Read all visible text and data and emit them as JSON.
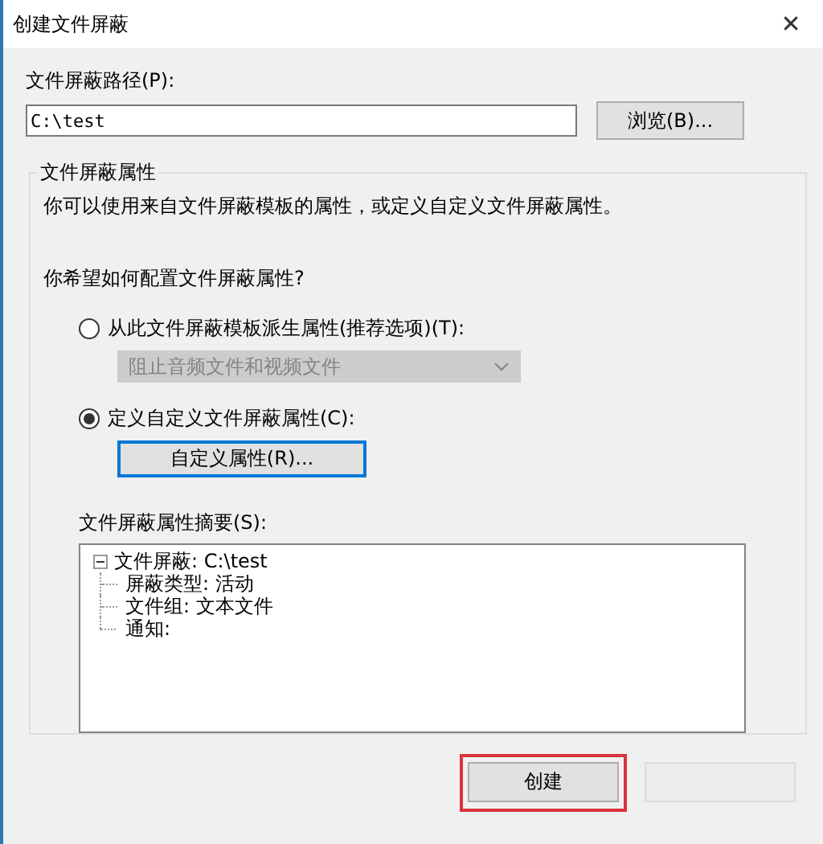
{
  "window": {
    "title": "创建文件屏蔽",
    "close": "✕"
  },
  "path": {
    "label": "文件屏蔽路径(P):",
    "value": "C:\\test",
    "browse": "浏览(B)..."
  },
  "group": {
    "title": "文件屏蔽属性",
    "description": "你可以使用来自文件屏蔽模板的属性，或定义自定义文件屏蔽属性。",
    "question": "你希望如何配置文件屏蔽属性?",
    "options": [
      {
        "label": "从此文件屏蔽模板派生属性(推荐选项)(T):",
        "selected": false,
        "kind": "template",
        "dropdown": {
          "value": "阻止音频文件和视频文件",
          "disabled": true
        }
      },
      {
        "label": "定义自定义文件屏蔽属性(C):",
        "selected": true,
        "kind": "custom",
        "button": "自定义属性(R)..."
      }
    ],
    "summary": {
      "label": "文件屏蔽属性摘要(S):",
      "tree": [
        {
          "text": "文件屏蔽: C:\\test",
          "expanded": true,
          "children": [
            {
              "text": "屏蔽类型: 活动"
            },
            {
              "text": "文件组: 文本文件"
            },
            {
              "text": "通知:"
            }
          ]
        }
      ]
    }
  },
  "buttons": [
    {
      "label": "创建",
      "highlighted": true
    },
    {
      "highlighted": false
    }
  ]
}
